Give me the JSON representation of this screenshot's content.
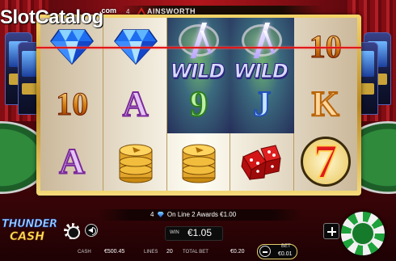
{
  "watermark": {
    "text": "SlotCatalog",
    "suffix": ".com"
  },
  "header": {
    "provider": "AINSWORTH",
    "counter": "4"
  },
  "reels": [
    [
      {
        "symbol": "diamond-icon"
      },
      {
        "symbol": "10"
      },
      {
        "symbol": "A"
      }
    ],
    [
      {
        "symbol": "diamond-icon"
      },
      {
        "symbol": "A"
      },
      {
        "symbol": "coins-icon"
      }
    ],
    [
      {
        "symbol": "wild",
        "text": "WILD"
      },
      {
        "symbol": "9"
      },
      {
        "symbol": "coins-icon"
      }
    ],
    [
      {
        "symbol": "wild",
        "text": "WILD"
      },
      {
        "symbol": "J"
      },
      {
        "symbol": "dice-icon"
      }
    ],
    [
      {
        "symbol": "10"
      },
      {
        "symbol": "K"
      },
      {
        "symbol": "7"
      }
    ]
  ],
  "win_message": {
    "count": "4",
    "text": "On Line 2 Awards €1.00"
  },
  "win": {
    "label": "WIN",
    "value": "€1.05"
  },
  "info": {
    "cash_label": "CASH",
    "cash_value": "€500.45",
    "lines_label": "LINES",
    "lines_value": "20",
    "total_bet_label": "TOTAL BET",
    "total_bet_value": "€0.20"
  },
  "bet": {
    "label": "BET",
    "value": "€0.01"
  },
  "game_logo": {
    "line1": "THUNDER",
    "line2": "CASH"
  },
  "colors": {
    "payline": "#e01818",
    "frame": "#d9a93a",
    "spin_green": "#1ea23b"
  }
}
